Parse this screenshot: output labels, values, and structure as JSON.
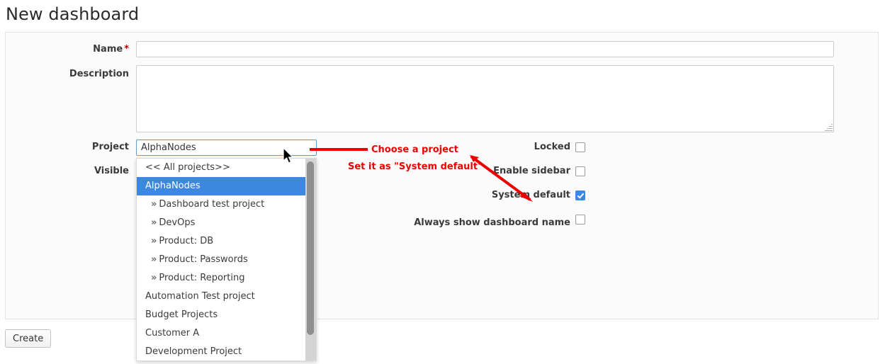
{
  "page": {
    "title": "New dashboard"
  },
  "form": {
    "fields": {
      "name": {
        "label": "Name",
        "required_marker": "*",
        "value": "",
        "placeholder": ""
      },
      "description": {
        "label": "Description",
        "value": "",
        "placeholder": ""
      },
      "project": {
        "label": "Project",
        "value": "AlphaNodes"
      },
      "visible": {
        "label": "Visible",
        "value": ""
      }
    },
    "project_dropdown": {
      "open": true,
      "selected": "AlphaNodes",
      "options": [
        {
          "label": "<< All projects>>",
          "child": false,
          "selected": false
        },
        {
          "label": "AlphaNodes",
          "child": false,
          "selected": true
        },
        {
          "label": "Dashboard test project",
          "child": true,
          "selected": false
        },
        {
          "label": "DevOps",
          "child": true,
          "selected": false
        },
        {
          "label": "Product: DB",
          "child": true,
          "selected": false
        },
        {
          "label": "Product: Passwords",
          "child": true,
          "selected": false
        },
        {
          "label": "Product: Reporting",
          "child": true,
          "selected": false
        },
        {
          "label": "Automation Test project",
          "child": false,
          "selected": false
        },
        {
          "label": "Budget Projects",
          "child": false,
          "selected": false
        },
        {
          "label": "Customer A",
          "child": false,
          "selected": false
        },
        {
          "label": "Development Project",
          "child": false,
          "selected": false
        }
      ],
      "child_prefix": "»"
    },
    "checkboxes": [
      {
        "label": "Locked",
        "checked": false
      },
      {
        "label": "Enable sidebar",
        "checked": false
      },
      {
        "label": "System default",
        "checked": true
      },
      {
        "label": "Always show dashboard name",
        "checked": false
      }
    ],
    "create_button": "Create"
  },
  "annotations": {
    "line1": "Choose a project",
    "line2": "Set it as \"System default\"",
    "color": "#ee0000"
  },
  "colors": {
    "accent_blue": "#3c87e0",
    "annotation_red": "#ee0000",
    "required_red": "#bb0000",
    "panel_bg": "#fbfbfb"
  }
}
